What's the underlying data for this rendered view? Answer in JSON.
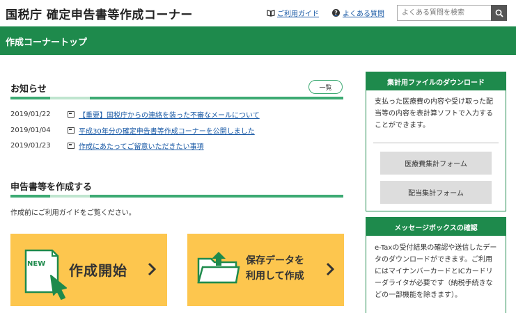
{
  "header": {
    "site_title": "国税庁 確定申告書等作成コーナー",
    "guide_link": "ご利用ガイド",
    "faq_link": "よくある質問",
    "search_placeholder": "よくある質問を検索",
    "q_glyph": "?"
  },
  "banner": {
    "title": "作成コーナートップ"
  },
  "news": {
    "title": "お知らせ",
    "list_button": "一覧",
    "items": [
      {
        "date": "2019/01/22",
        "text": "【重要】国税庁からの連絡を装った不審なメールについて"
      },
      {
        "date": "2019/01/04",
        "text": "平成30年分の確定申告書等作成コーナーを公開しました"
      },
      {
        "date": "2019/01/23",
        "text": "作成にあたってご留意いただきたい事項"
      }
    ]
  },
  "create": {
    "title": "申告書等を作成する",
    "note": "作成前にご利用ガイドをご覧ください。",
    "tile_new_badge": "NEW",
    "tile_start_label": "作成開始",
    "tile_saved_line1": "保存データを",
    "tile_saved_line2": "利用して作成"
  },
  "sidebar": {
    "download": {
      "title": "集計用ファイルのダウンロード",
      "text": "支払った医療費の内容や受け取った配当等の内容を表計算ソフトで入力することができます。",
      "buttons": [
        "医療費集計フォーム",
        "配当集計フォーム"
      ]
    },
    "messagebox": {
      "title": "メッセージボックスの確認",
      "text": "e-Taxの受付結果の確認や送信したデータのダウンロードができます。ご利用にはマイナンバーカードとICカードリーダライタが必要です（納税手続きなどの一部機能を除きます）。"
    }
  },
  "colors": {
    "brand_green": "#1e8a4c",
    "accent_green": "#3daa73",
    "tile_yellow": "#fdc64e",
    "link_blue": "#1a5aa6"
  }
}
